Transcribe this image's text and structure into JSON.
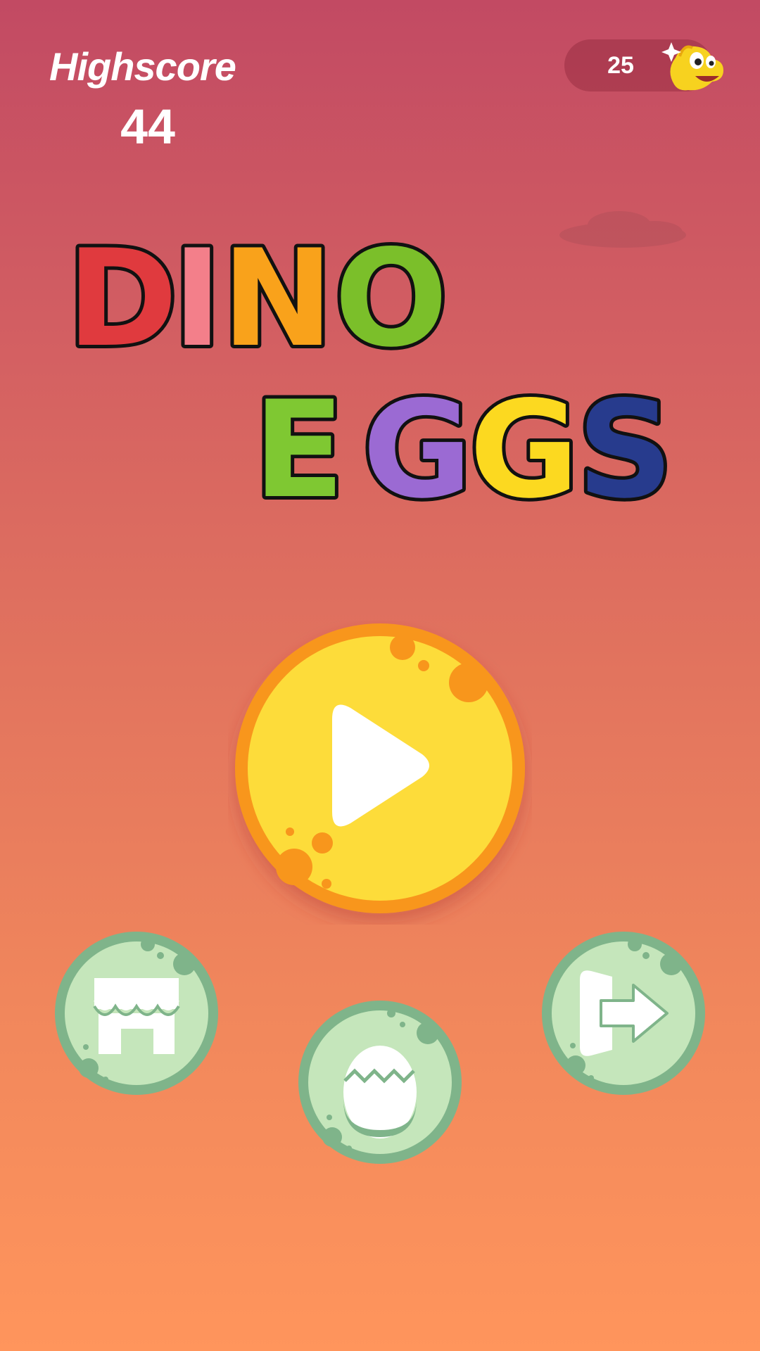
{
  "header": {
    "highscore_label": "Highscore",
    "highscore_value": "44",
    "coins": "25"
  },
  "title": {
    "line1": [
      "D",
      "I",
      "N",
      "O"
    ],
    "line2": [
      "E",
      "G",
      "G",
      "S"
    ]
  },
  "buttons": {
    "play": "play-icon",
    "shop": "shop-icon",
    "eggs": "egg-icon",
    "exit": "exit-icon"
  },
  "colors": {
    "play_fill": "#fddc3a",
    "play_ring": "#f8961c",
    "round_fill": "#c5e6bb",
    "round_ring": "#7fb48a"
  }
}
